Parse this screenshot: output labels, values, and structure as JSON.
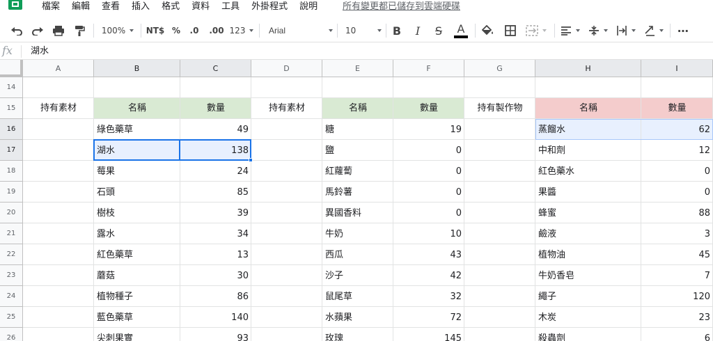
{
  "menu": [
    "檔案",
    "編輯",
    "查看",
    "插入",
    "格式",
    "資料",
    "工具",
    "外掛程式",
    "說明"
  ],
  "save_status": "所有變更都已儲存到雲端硬碟",
  "toolbar": {
    "zoom": "100%",
    "currency": "NT$",
    "percent": "%",
    "decrease_decimals": ".0",
    "increase_decimals": ".00",
    "more_formats": "123",
    "font": "Arial",
    "font_size": "10",
    "bold": "B",
    "italic": "I",
    "strikethrough": "S",
    "text_color_letter": "A",
    "text_color": "#000000",
    "more": "⋯"
  },
  "formula_bar": {
    "fx": "fx",
    "value": "湖水"
  },
  "columns": [
    "A",
    "B",
    "C",
    "D",
    "E",
    "F",
    "G",
    "H",
    "I"
  ],
  "selected_columns": [
    "B",
    "C",
    "H",
    "I"
  ],
  "selected_rows": [
    "16",
    "17"
  ],
  "rows": [
    {
      "num": "14",
      "cells": [
        "",
        "",
        "",
        "",
        "",
        "",
        "",
        "",
        ""
      ]
    },
    {
      "num": "15",
      "cells": [
        "持有素材",
        "名稱",
        "數量",
        "持有素材",
        "名稱",
        "數量",
        "持有製作物",
        "名稱",
        "數量"
      ]
    },
    {
      "num": "16",
      "cells": [
        "",
        "綠色藥草",
        "49",
        "",
        "糖",
        "19",
        "",
        "蒸餾水",
        "62"
      ]
    },
    {
      "num": "17",
      "cells": [
        "",
        "湖水",
        "138",
        "",
        "鹽",
        "0",
        "",
        "中和劑",
        "12"
      ]
    },
    {
      "num": "18",
      "cells": [
        "",
        "莓果",
        "24",
        "",
        "紅蘿蔔",
        "0",
        "",
        "紅色藥水",
        "0"
      ]
    },
    {
      "num": "19",
      "cells": [
        "",
        "石頭",
        "85",
        "",
        "馬鈴薯",
        "0",
        "",
        "果醬",
        "0"
      ]
    },
    {
      "num": "20",
      "cells": [
        "",
        "樹枝",
        "39",
        "",
        "異國香料",
        "0",
        "",
        "蜂蜜",
        "88"
      ]
    },
    {
      "num": "21",
      "cells": [
        "",
        "露水",
        "34",
        "",
        "牛奶",
        "10",
        "",
        "鹼液",
        "3"
      ]
    },
    {
      "num": "22",
      "cells": [
        "",
        "紅色藥草",
        "13",
        "",
        "西瓜",
        "43",
        "",
        "植物油",
        "45"
      ]
    },
    {
      "num": "23",
      "cells": [
        "",
        "蘑菇",
        "30",
        "",
        "沙子",
        "42",
        "",
        "牛奶香皂",
        "7"
      ]
    },
    {
      "num": "24",
      "cells": [
        "",
        "植物種子",
        "86",
        "",
        "鼠尾草",
        "32",
        "",
        "繩子",
        "120"
      ]
    },
    {
      "num": "25",
      "cells": [
        "",
        "藍色藥草",
        "140",
        "",
        "水蘋果",
        "72",
        "",
        "木炭",
        "23"
      ]
    },
    {
      "num": "26",
      "cells": [
        "",
        "尖刺果實",
        "93",
        "",
        "玫瑰",
        "145",
        "",
        "殺蟲劑",
        "6"
      ]
    }
  ],
  "colors": {
    "header_green": "#d9ead3",
    "header_red": "#f4cccc",
    "selection_blue": "#1a73e8",
    "selection_fill": "#e8f0fe",
    "logo_green": "#0f9d58"
  }
}
